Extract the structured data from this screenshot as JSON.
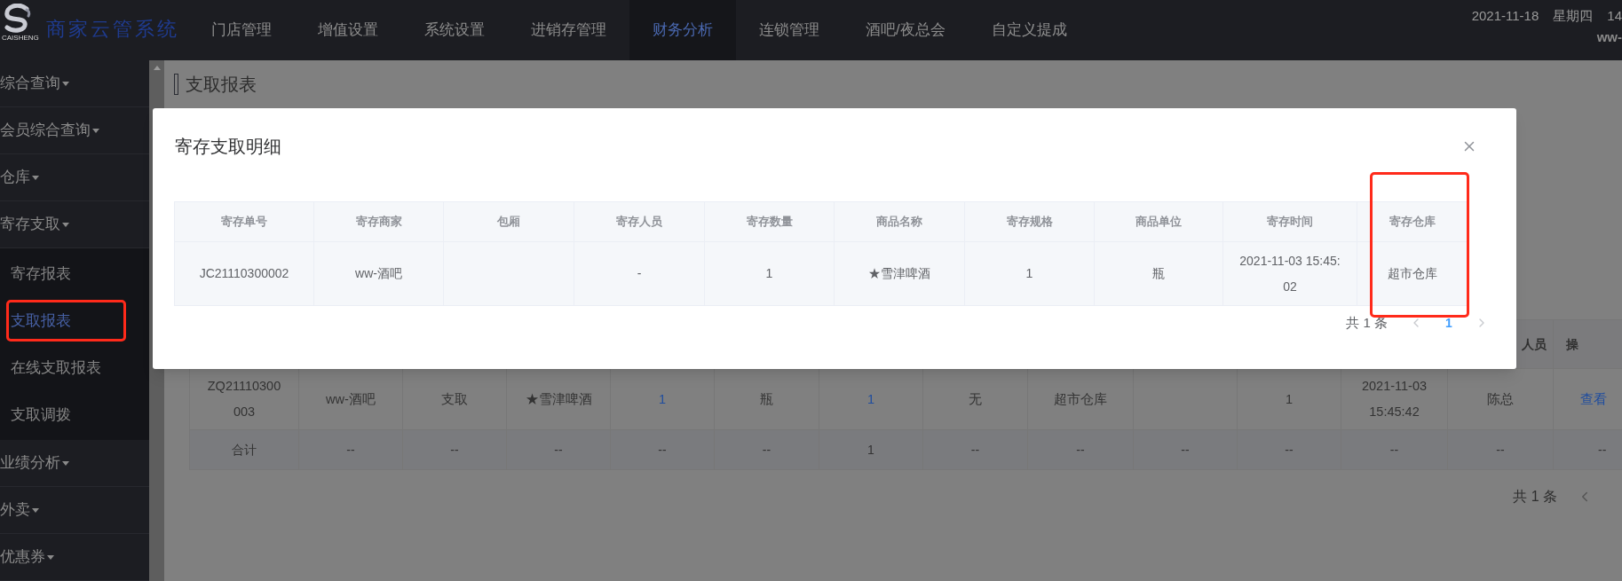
{
  "header": {
    "logo_text": "CAISHENG",
    "brand": "商家云管系统",
    "nav": [
      {
        "label": "门店管理",
        "selected": false
      },
      {
        "label": "增值设置",
        "selected": false
      },
      {
        "label": "系统设置",
        "selected": false
      },
      {
        "label": "进销存管理",
        "selected": false
      },
      {
        "label": "财务分析",
        "selected": true
      },
      {
        "label": "连锁管理",
        "selected": false
      },
      {
        "label": "酒吧/夜总会",
        "selected": false
      },
      {
        "label": "自定义提成",
        "selected": false
      }
    ],
    "date": "2021-11-18",
    "weekday": "星期四",
    "time": "14",
    "user": "ww-"
  },
  "sidebar": {
    "items": [
      {
        "label": "综合查询"
      },
      {
        "label": "会员综合查询"
      },
      {
        "label": "仓库"
      },
      {
        "label": "寄存支取",
        "children": [
          {
            "label": "寄存报表",
            "selected": false,
            "highlighted": false
          },
          {
            "label": "支取报表",
            "selected": true,
            "highlighted": true
          },
          {
            "label": "在线支取报表",
            "selected": false,
            "highlighted": false
          },
          {
            "label": "支取调拨",
            "selected": false,
            "highlighted": false
          }
        ]
      },
      {
        "label": "业绩分析"
      },
      {
        "label": "外卖"
      },
      {
        "label": "优惠券"
      }
    ]
  },
  "page": {
    "title": "支取报表",
    "table": {
      "visible_headers": [
        "人员",
        "操"
      ],
      "rows": [
        [
          "ZQ21110300003",
          "ww-酒吧",
          "支取",
          "★雪津啤酒",
          {
            "text": "1",
            "link": true
          },
          "瓶",
          {
            "text": "1",
            "link": true
          },
          "无",
          "超市仓库",
          "",
          "1",
          "2021-11-03 15:45:42",
          "陈总",
          {
            "text": "查看",
            "link": true
          }
        ]
      ],
      "total_row": [
        "合计",
        "--",
        "--",
        "--",
        "--",
        "--",
        "1",
        "--",
        "--",
        "--",
        "--",
        "--",
        "--",
        "--"
      ]
    },
    "pagination": {
      "total": "共 1 条"
    }
  },
  "dialog": {
    "title": "寄存支取明细",
    "columns": [
      {
        "label": "寄存单号",
        "highlighted": false
      },
      {
        "label": "寄存商家",
        "highlighted": false
      },
      {
        "label": "包厢",
        "highlighted": false
      },
      {
        "label": "寄存人员",
        "highlighted": false
      },
      {
        "label": "寄存数量",
        "highlighted": false
      },
      {
        "label": "商品名称",
        "highlighted": false
      },
      {
        "label": "寄存规格",
        "highlighted": false
      },
      {
        "label": "商品单位",
        "highlighted": false
      },
      {
        "label": "寄存时间",
        "highlighted": false
      },
      {
        "label": "寄存仓库",
        "highlighted": true
      }
    ],
    "rows": [
      [
        "JC21110300002",
        "ww-酒吧",
        "",
        "-",
        "1",
        "★雪津啤酒",
        "1",
        "瓶",
        "2021-11-03 15:45:02",
        "超市仓库"
      ]
    ],
    "pagination": {
      "total": "共 1 条",
      "prev_disabled": true,
      "next_disabled": true,
      "pages": [
        {
          "label": "1",
          "selected": true
        }
      ]
    }
  }
}
